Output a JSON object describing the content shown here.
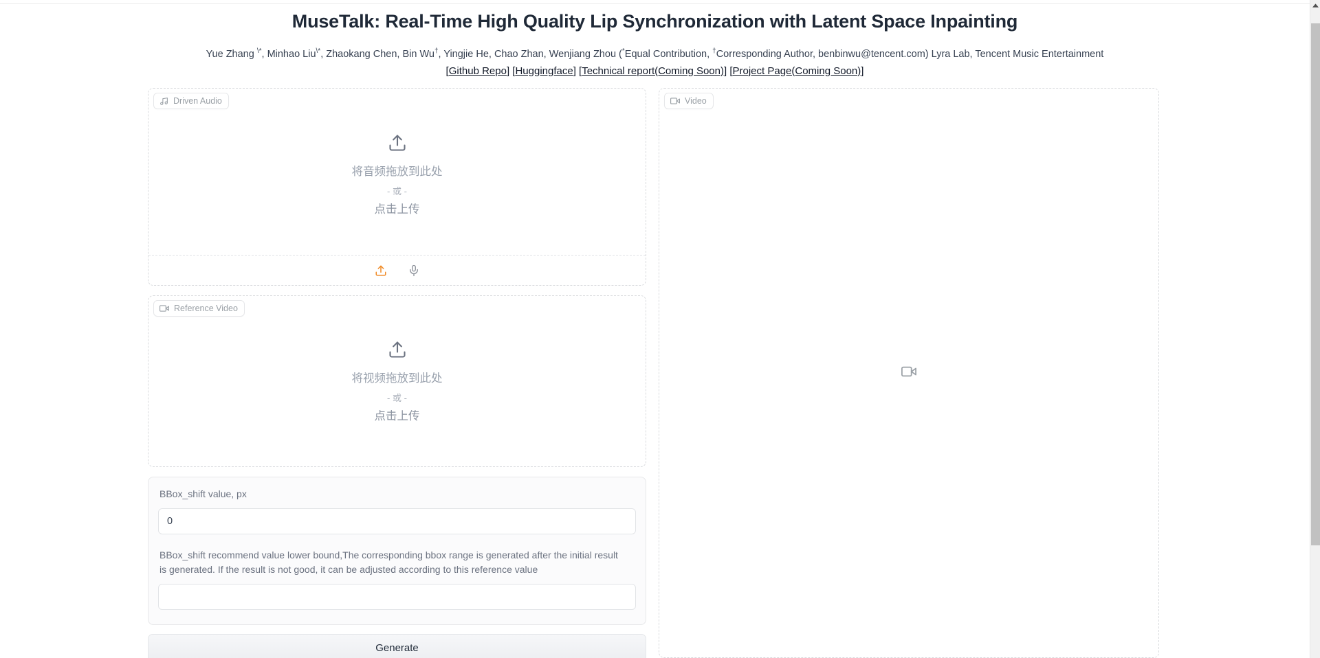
{
  "header": {
    "title": "MuseTalk: Real-Time High Quality Lip Synchronization with Latent Space Inpainting",
    "authors_part1": "Yue Zhang ",
    "authors_sup1": "\\*",
    "authors_part2": ", Minhao Liu",
    "authors_sup2": "\\*",
    "authors_part3": ", Zhaokang Chen, Bin Wu",
    "authors_sup3": "†",
    "authors_part4": ", Yingjie He, Chao Zhan, Wenjiang Zhou (",
    "authors_sup4": "*",
    "authors_part5": "Equal Contribution, ",
    "authors_sup5": "†",
    "authors_part6": "Corresponding Author, benbinwu@tencent.com) Lyra Lab, Tencent Music Entertainment",
    "links": [
      {
        "prefix": "[",
        "label": "Github Repo",
        "suffix": "] "
      },
      {
        "prefix": "[",
        "label": "Huggingface",
        "suffix": "] "
      },
      {
        "prefix": "[",
        "label": "Technical report(Coming Soon)",
        "suffix": "] "
      },
      {
        "prefix": "[",
        "label": "Project Page(Coming Soon)",
        "suffix": "]"
      }
    ]
  },
  "driven_audio": {
    "label": "Driven Audio",
    "icon": "music-note-icon",
    "drop_text": "将音频拖放到此处",
    "or_text": "- 或 -",
    "click_text": "点击上传",
    "upload_icon": "upload-icon",
    "mic_icon": "microphone-icon",
    "upload_icon_color": "#f08a25",
    "mic_icon_color": "#6b7280"
  },
  "reference_video": {
    "label": "Reference Video",
    "icon": "video-camera-icon",
    "drop_text": "将视频拖放到此处",
    "or_text": "- 或 -",
    "click_text": "点击上传"
  },
  "params": {
    "bbox_shift_label": "BBox_shift value, px",
    "bbox_shift_value": "0",
    "bbox_shift_desc": "BBox_shift recommend value lower bound,The corresponding bbox range is generated after the initial result is generated. If the result is not good, it can be adjusted according to this reference value",
    "bbox_result_value": "",
    "generate_label": "Generate"
  },
  "video_output": {
    "label": "Video",
    "icon": "video-camera-icon",
    "placeholder_icon": "video-camera-placeholder-icon"
  },
  "scrollbar": {
    "up_arrow_icon": "scroll-up-arrow-icon"
  },
  "colors": {
    "accent_orange": "#f08a25",
    "text_dark": "#1f2937",
    "text_muted": "#9aa0a6",
    "border": "#e6e7e9"
  }
}
